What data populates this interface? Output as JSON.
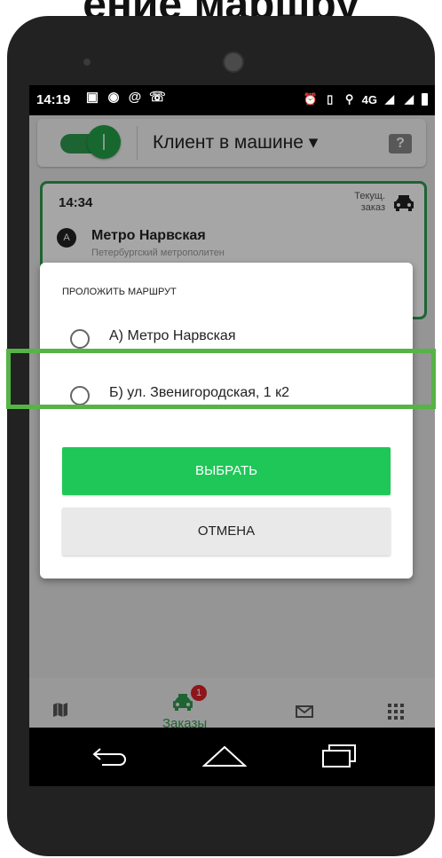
{
  "page_header": {
    "title": "ение маршру"
  },
  "status_bar": {
    "time": "14:19",
    "network": "4G"
  },
  "top_bar": {
    "toggle_state": "on",
    "title": "Клиент в машине ▾",
    "help_label": "?"
  },
  "order_card": {
    "time": "14:34",
    "status_line1": "Текущ.",
    "status_line2": "заказ",
    "point_letter": "A",
    "address": "Метро Нарвская",
    "subtitle": "Петербургский метрополитен"
  },
  "dialog": {
    "title": "ПРОЛОЖИТЬ МАРШРУТ",
    "options": [
      {
        "label": "А) Метро Нарвская",
        "selected": false
      },
      {
        "label": "Б) ул. Звенигородская, 1 к2",
        "selected": false
      }
    ],
    "confirm_label": "ВЫБРАТЬ",
    "cancel_label": "ОТМЕНА"
  },
  "bottom_nav": {
    "items": [
      {
        "icon": "map-icon",
        "label": ""
      },
      {
        "icon": "taxi-icon",
        "label": "Заказы",
        "badge": "1",
        "active": true
      },
      {
        "icon": "mail-icon",
        "label": ""
      },
      {
        "icon": "grid-icon",
        "label": ""
      }
    ]
  },
  "colors": {
    "accent_green": "#2e9a4f",
    "button_green": "#1ec758",
    "badge_red": "#d9232a",
    "highlight_green": "#56b346"
  }
}
